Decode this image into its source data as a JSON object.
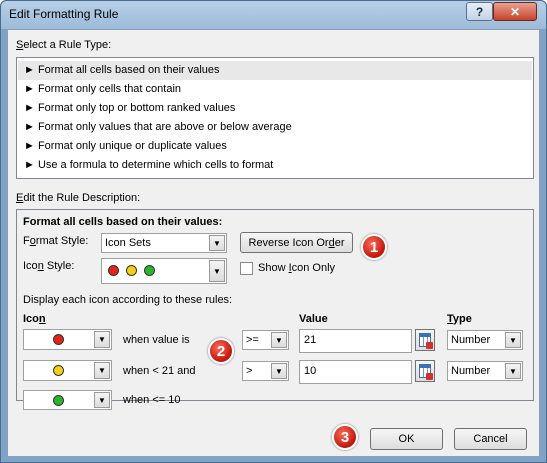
{
  "window": {
    "title": "Edit Formatting Rule",
    "help_glyph": "?",
    "close_glyph": "✕"
  },
  "rule_type": {
    "label_prefix": "S",
    "label_rest": "elect a Rule Type:",
    "items": [
      "► Format all cells based on their values",
      "► Format only cells that contain",
      "► Format only top or bottom ranked values",
      "► Format only values that are above or below average",
      "► Format only unique or duplicate values",
      "► Use a formula to determine which cells to format"
    ],
    "selected_index": 0
  },
  "description": {
    "label_prefix": "E",
    "label_rest": "dit the Rule Description:",
    "heading": "Format all cells based on their values:",
    "format_style_label_pre": "F",
    "format_style_label_u": "o",
    "format_style_label_post": "rmat Style:",
    "format_style_value": "Icon Sets",
    "reverse_button_pre": "Reverse Icon Or",
    "reverse_button_u": "d",
    "reverse_button_post": "er",
    "icon_style_label_pre": "Ico",
    "icon_style_label_u": "n",
    "icon_style_label_post": " Style:",
    "show_icon_only_pre": "Show ",
    "show_icon_only_u": "I",
    "show_icon_only_post": "con Only",
    "show_icon_only_checked": false,
    "display_rules_label": "Display each icon according to these rules:",
    "col_icon_pre": "Ico",
    "col_icon_u": "n",
    "col_value": "Value",
    "col_type_pre": "",
    "col_type_u": "T",
    "col_type_post": "ype",
    "rows": [
      {
        "icon_color": "#e0261b",
        "condition_text": "when value is",
        "operator": ">=",
        "value": "21",
        "type": "Number"
      },
      {
        "icon_color": "#f2cf19",
        "condition_text": "when < 21 and",
        "operator": ">",
        "value": "10",
        "type": "Number"
      },
      {
        "icon_color": "#2bb52b",
        "condition_text": "when <= 10"
      }
    ]
  },
  "icon_style_colors": [
    "#e0261b",
    "#f2cf19",
    "#2bb52b"
  ],
  "buttons": {
    "ok": "OK",
    "cancel": "Cancel"
  },
  "badges": [
    "1",
    "2",
    "3"
  ],
  "badge_color": "#d2231b"
}
